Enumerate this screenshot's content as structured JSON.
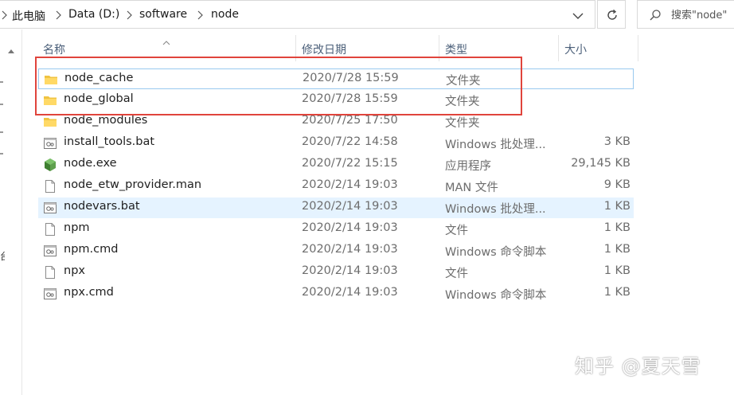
{
  "breadcrumb": {
    "items": [
      "此电脑",
      "Data (D:)",
      "software",
      "node"
    ]
  },
  "search": {
    "placeholder": "搜索\"node\""
  },
  "columns": {
    "name": "名称",
    "modified": "修改日期",
    "type": "类型",
    "size": "大小"
  },
  "left_pane": {
    "label_fragment": "台"
  },
  "files": [
    {
      "name": "node_cache",
      "modified": "2020/7/28 15:59",
      "type": "文件夹",
      "size": "",
      "icon": "folder-icon"
    },
    {
      "name": "node_global",
      "modified": "2020/7/28 15:59",
      "type": "文件夹",
      "size": "",
      "icon": "folder-icon"
    },
    {
      "name": "node_modules",
      "modified": "2020/7/25 17:50",
      "type": "文件夹",
      "size": "",
      "icon": "folder-icon"
    },
    {
      "name": "install_tools.bat",
      "modified": "2020/7/22 14:58",
      "type": "Windows 批处理...",
      "size": "3 KB",
      "icon": "batch-file-icon"
    },
    {
      "name": "node.exe",
      "modified": "2020/7/22 15:15",
      "type": "应用程序",
      "size": "29,145 KB",
      "icon": "nodejs-exe-icon"
    },
    {
      "name": "node_etw_provider.man",
      "modified": "2020/2/14 19:03",
      "type": "MAN 文件",
      "size": "9 KB",
      "icon": "file-icon"
    },
    {
      "name": "nodevars.bat",
      "modified": "2020/2/14 19:03",
      "type": "Windows 批处理...",
      "size": "1 KB",
      "icon": "batch-file-icon"
    },
    {
      "name": "npm",
      "modified": "2020/2/14 19:03",
      "type": "文件",
      "size": "1 KB",
      "icon": "file-icon"
    },
    {
      "name": "npm.cmd",
      "modified": "2020/2/14 19:03",
      "type": "Windows 命令脚本",
      "size": "1 KB",
      "icon": "cmd-file-icon"
    },
    {
      "name": "npx",
      "modified": "2020/2/14 19:03",
      "type": "文件",
      "size": "1 KB",
      "icon": "file-icon"
    },
    {
      "name": "npx.cmd",
      "modified": "2020/2/14 19:03",
      "type": "Windows 命令脚本",
      "size": "1 KB",
      "icon": "cmd-file-icon"
    }
  ],
  "state": {
    "selected_row": 0,
    "hover_row": 6
  },
  "colors": {
    "annotation_box": "#e0443c",
    "selection_border": "#99c9ef",
    "hover_bg": "#e5f3ff",
    "header_text": "#4c607a"
  },
  "watermark": "知乎 @夏天雪"
}
